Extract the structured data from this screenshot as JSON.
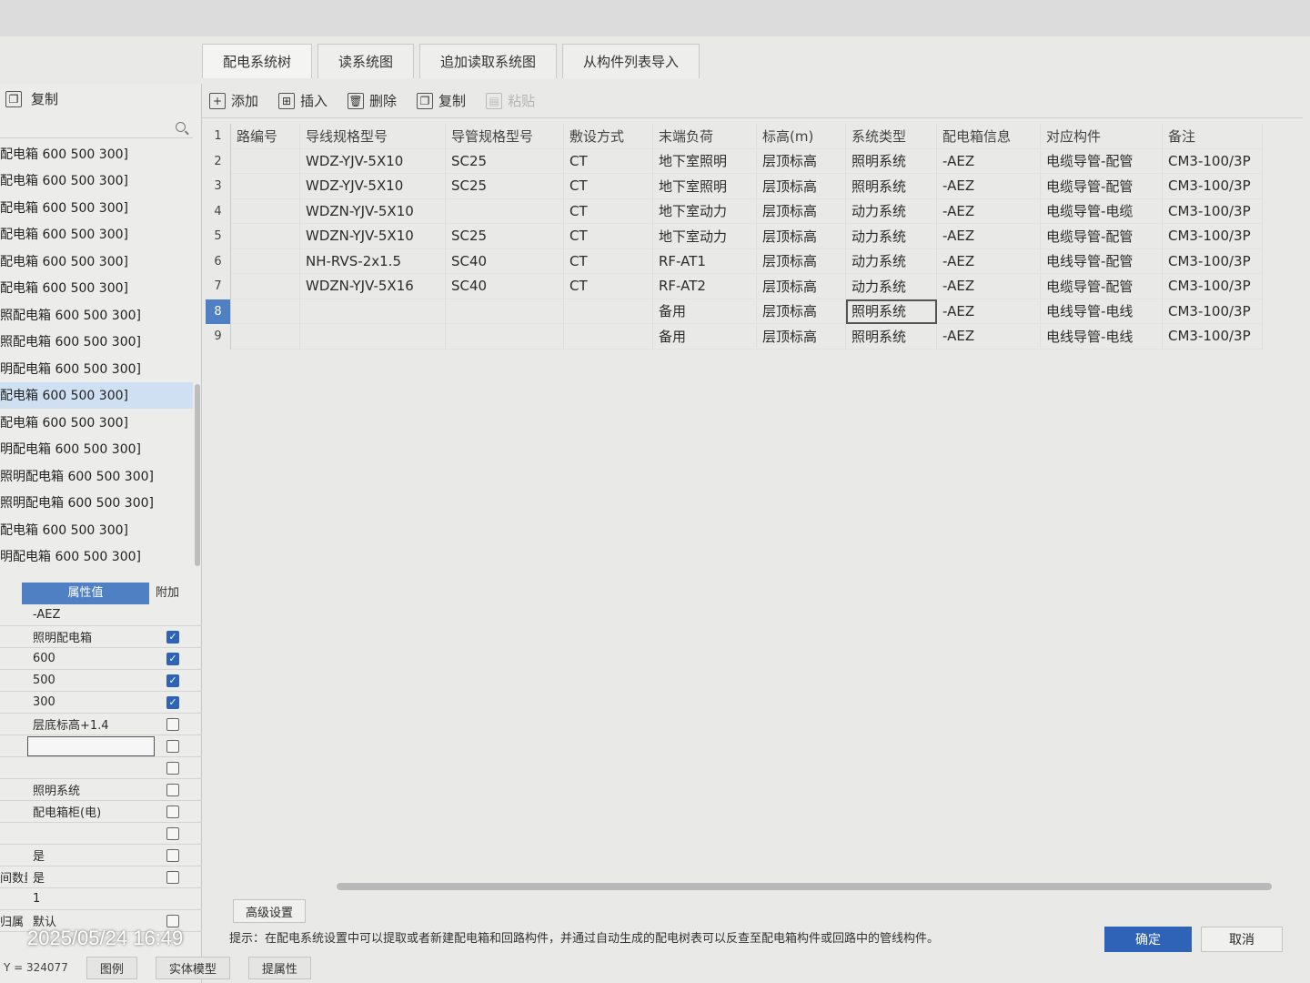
{
  "tabs": [
    "配电系统树",
    "读系统图",
    "追加读取系统图",
    "从构件列表导入"
  ],
  "toolbar": {
    "add": "添加",
    "insert": "插入",
    "delete": "删除",
    "copy": "复制",
    "paste": "粘贴"
  },
  "left": {
    "copy_label": "复制",
    "tree_items": [
      "配电箱 600 500 300]",
      "配电箱 600 500 300]",
      "配电箱 600 500 300]",
      "配电箱 600 500 300]",
      "配电箱 600 500 300]",
      "配电箱 600 500 300]",
      "照配电箱 600 500 300]",
      "照配电箱 600 500 300]",
      "明配电箱 600 500 300]",
      "配电箱 600 500 300]",
      "配电箱 600 500 300]",
      "明配电箱 600 500 300]",
      "照明配电箱 600 500 300]",
      "照明配电箱 600 500 300]",
      "配电箱 600 500 300]",
      "明配电箱 600 500 300]"
    ],
    "selected_index": 9,
    "props_header": {
      "value": "属性值",
      "attach": "附加"
    },
    "props": [
      {
        "label": "",
        "value": "-AEZ",
        "checked": null
      },
      {
        "label": "",
        "value": "照明配电箱",
        "checked": true
      },
      {
        "label": "",
        "value": "600",
        "checked": true
      },
      {
        "label": "",
        "value": "500",
        "checked": true
      },
      {
        "label": "",
        "value": "300",
        "checked": true
      },
      {
        "label": "",
        "value": "层底标高+1.4",
        "checked": false
      },
      {
        "label": "",
        "value": "",
        "checked": false,
        "editing": true
      },
      {
        "label": "",
        "value": "",
        "checked": false
      },
      {
        "label": "",
        "value": "照明系统",
        "checked": false
      },
      {
        "label": "",
        "value": "配电箱柜(电)",
        "checked": false
      },
      {
        "label": "",
        "value": "",
        "checked": false
      },
      {
        "label": "",
        "value": "是",
        "checked": false
      },
      {
        "label": "间数量",
        "value": "是",
        "checked": false
      },
      {
        "label": "",
        "value": "1",
        "checked": null
      },
      {
        "label": "归属",
        "value": "默认",
        "checked": false
      }
    ]
  },
  "table": {
    "headers": [
      "路编号",
      "导线规格型号",
      "导管规格型号",
      "敷设方式",
      "末端负荷",
      "标高(m)",
      "系统类型",
      "配电箱信息",
      "对应构件",
      "备注"
    ],
    "rows": [
      [
        "",
        "WDZ-YJV-5X10",
        "SC25",
        "CT",
        "地下室照明",
        "层顶标高",
        "照明系统",
        "-AEZ",
        "电缆导管-配管",
        "CM3-100/3P"
      ],
      [
        "",
        "WDZ-YJV-5X10",
        "SC25",
        "CT",
        "地下室照明",
        "层顶标高",
        "照明系统",
        "-AEZ",
        "电缆导管-配管",
        "CM3-100/3P"
      ],
      [
        "",
        "WDZN-YJV-5X10",
        "",
        "CT",
        "地下室动力",
        "层顶标高",
        "动力系统",
        "-AEZ",
        "电缆导管-电缆",
        "CM3-100/3P"
      ],
      [
        "",
        "WDZN-YJV-5X10",
        "SC25",
        "CT",
        "地下室动力",
        "层顶标高",
        "动力系统",
        "-AEZ",
        "电缆导管-配管",
        "CM3-100/3P"
      ],
      [
        "",
        "NH-RVS-2x1.5",
        "SC40",
        "CT",
        "RF-AT1",
        "层顶标高",
        "动力系统",
        "-AEZ",
        "电线导管-配管",
        "CM3-100/3P"
      ],
      [
        "",
        "WDZN-YJV-5X16",
        "SC40",
        "CT",
        "RF-AT2",
        "层顶标高",
        "动力系统",
        "-AEZ",
        "电缆导管-配管",
        "CM3-100/3P"
      ],
      [
        "",
        "",
        "",
        "",
        "备用",
        "层顶标高",
        "照明系统",
        "-AEZ",
        "电线导管-电线",
        "CM3-100/3P"
      ],
      [
        "",
        "",
        "",
        "",
        "备用",
        "层顶标高",
        "照明系统",
        "-AEZ",
        "电线导管-电线",
        "CM3-100/3P"
      ]
    ],
    "row_numbers": [
      "1",
      "2",
      "3",
      "4",
      "5",
      "6",
      "7",
      "8",
      "9"
    ],
    "selected_row": 8
  },
  "footer": {
    "advanced": "高级设置",
    "hint": "提示：在配电系统设置中可以提取或者新建配电箱和回路构件，并通过自动生成的配电树表可以反查至配电箱构件或回路中的管线构件。",
    "ok": "确定",
    "cancel": "取消"
  },
  "overlay": {
    "timestamp": "2025/05/24 16:49",
    "bottom_tabs": [
      "图例",
      "实体模型",
      "提属性"
    ],
    "coord": "Y = 324077"
  }
}
